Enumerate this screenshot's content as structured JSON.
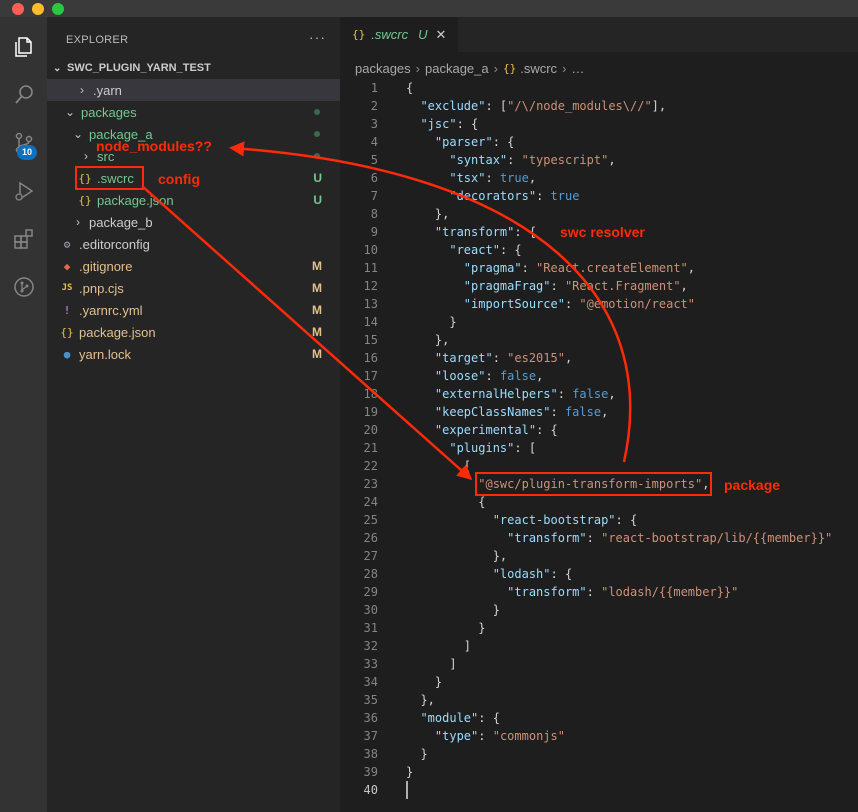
{
  "window": {
    "controls": [
      "close",
      "minimize",
      "zoom"
    ]
  },
  "activity_bar": {
    "items": [
      "files-icon",
      "search-icon",
      "source-control-icon",
      "run-debug-icon",
      "extensions-icon",
      "git-graph-icon"
    ],
    "scm_badge": "10"
  },
  "sidebar": {
    "title": "EXPLORER",
    "more": "···",
    "section": "SWC_PLUGIN_YARN_TEST",
    "tree": [
      {
        "label": ".yarn",
        "type": "folder",
        "expanded": false,
        "status": ""
      },
      {
        "label": "packages",
        "type": "folder",
        "expanded": true,
        "status": "dot"
      },
      {
        "label": "package_a",
        "type": "folder",
        "expanded": true,
        "status": "dot"
      },
      {
        "label": "src",
        "type": "folder",
        "expanded": false,
        "status": "dot"
      },
      {
        "label": ".swcrc",
        "type": "json",
        "status": "U"
      },
      {
        "label": "package.json",
        "type": "json",
        "status": "U"
      },
      {
        "label": "package_b",
        "type": "folder",
        "expanded": false,
        "status": ""
      },
      {
        "label": ".editorconfig",
        "type": "gear",
        "status": ""
      },
      {
        "label": ".gitignore",
        "type": "git",
        "status": "M"
      },
      {
        "label": ".pnp.cjs",
        "type": "js",
        "status": "M"
      },
      {
        "label": ".yarnrc.yml",
        "type": "yml",
        "status": "M"
      },
      {
        "label": "package.json",
        "type": "json",
        "status": "M"
      },
      {
        "label": "yarn.lock",
        "type": "yarn",
        "status": "M"
      }
    ],
    "icons": {
      "json": "{}",
      "js": "JS",
      "yml": "!",
      "folder_closed": "›",
      "folder_open": "⌄"
    }
  },
  "editor": {
    "tab": {
      "icon": "{}",
      "name": ".swcrc",
      "status": "U",
      "close": "✕"
    },
    "breadcrumbs": [
      "packages",
      "package_a",
      ".swcrc",
      "…"
    ],
    "active_line": 40,
    "lines": [
      "{",
      "  \"exclude\": [\"/\\/node_modules\\//\"],",
      "  \"jsc\": {",
      "    \"parser\": {",
      "      \"syntax\": \"typescript\",",
      "      \"tsx\": true,",
      "      \"decorators\": true",
      "    },",
      "    \"transform\": {",
      "      \"react\": {",
      "        \"pragma\": \"React.createElement\",",
      "        \"pragmaFrag\": \"React.Fragment\",",
      "        \"importSource\": \"@emotion/react\"",
      "      }",
      "    },",
      "    \"target\": \"es2015\",",
      "    \"loose\": false,",
      "    \"externalHelpers\": false,",
      "    \"keepClassNames\": false,",
      "    \"experimental\": {",
      "      \"plugins\": [",
      "        [",
      "          \"@swc/plugin-transform-imports\",",
      "          {",
      "            \"react-bootstrap\": {",
      "              \"transform\": \"react-bootstrap/lib/{{member}}\"",
      "            },",
      "            \"lodash\": {",
      "              \"transform\": \"lodash/{{member}}\"",
      "            }",
      "          }",
      "        ]",
      "      ]",
      "    }",
      "  },",
      "  \"module\": {",
      "    \"type\": \"commonjs\"",
      "  }",
      "}",
      ""
    ]
  },
  "annotations": {
    "node_modules": "node_modules??",
    "config": "config",
    "swc_resolver": "swc resolver",
    "package": "package",
    "color": "#ff2a0a"
  }
}
